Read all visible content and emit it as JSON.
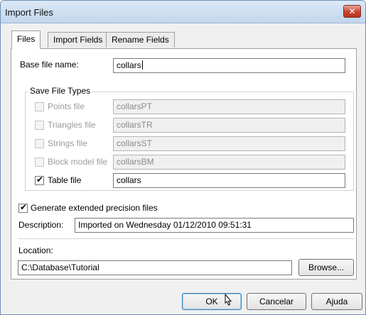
{
  "window": {
    "title": "Import Files",
    "close_glyph": "✕"
  },
  "tabs": [
    {
      "label": "Files",
      "active": true
    },
    {
      "label": "Import Fields",
      "active": false
    },
    {
      "label": "Rename Fields",
      "active": false
    }
  ],
  "base_file": {
    "label": "Base file name:",
    "value": "collars"
  },
  "save_file_types": {
    "legend": "Save File Types",
    "items": [
      {
        "label": "Points file",
        "value": "collarsPT",
        "checked": false,
        "enabled": false
      },
      {
        "label": "Triangles file",
        "value": "collarsTR",
        "checked": false,
        "enabled": false
      },
      {
        "label": "Strings file",
        "value": "collarsST",
        "checked": false,
        "enabled": false
      },
      {
        "label": "Block model file",
        "value": "collarsBM",
        "checked": false,
        "enabled": false
      },
      {
        "label": "Table file",
        "value": "collars",
        "checked": true,
        "enabled": true
      }
    ]
  },
  "extended_precision": {
    "label": "Generate extended precision files",
    "checked": true
  },
  "description": {
    "label": "Description:",
    "value": "Imported on Wednesday 01/12/2010 09:51:31"
  },
  "location": {
    "label": "Location:",
    "value": "C:\\Database\\Tutorial",
    "browse_label": "Browse..."
  },
  "buttons": {
    "ok": "OK",
    "cancel": "Cancelar",
    "help": "Ajuda"
  },
  "checkmark": "✔",
  "colors": {
    "titlebar": "#c2d6ed",
    "close": "#c8432d",
    "disabled_text": "#9b9b9b",
    "default_button_border": "#3c7fb1"
  }
}
